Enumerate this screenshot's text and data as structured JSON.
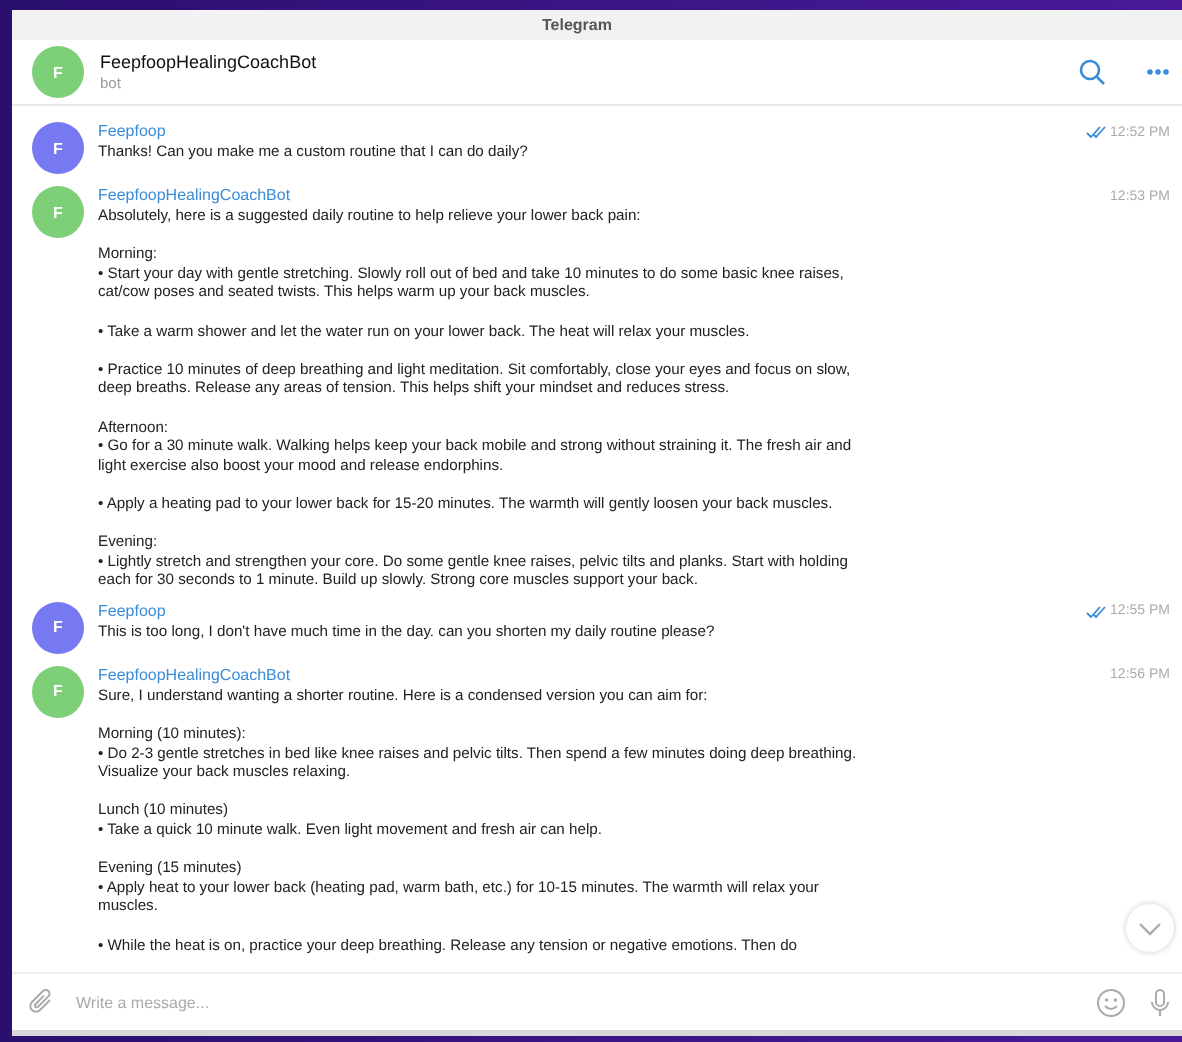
{
  "window": {
    "title": "Telegram"
  },
  "chat_header": {
    "avatar_letter": "F",
    "color": "#7dcf78",
    "name": "FeepfoopHealingCoachBot",
    "status": "bot"
  },
  "messages": [
    {
      "sender": "Feepfoop",
      "avatar_letter": "F",
      "color": "#7679f2",
      "time": "12:52 PM",
      "read": true,
      "blocks": [
        [
          "Thanks! Can you make me a custom routine that I can do daily?"
        ]
      ]
    },
    {
      "sender": "FeepfoopHealingCoachBot",
      "avatar_letter": "F",
      "color": "#7dcf78",
      "time": "12:53 PM",
      "read": false,
      "blocks": [
        [
          "Absolutely, here is a suggested daily routine to help relieve your lower back pain:"
        ],
        [
          "Morning:",
          "• Start your day with gentle stretching. Slowly roll out of bed and take 10 minutes to do some basic knee raises, cat/cow poses and seated twists. This helps warm up your back muscles."
        ],
        [
          "• Take a warm shower and let the water run on your lower back. The heat will relax your muscles."
        ],
        [
          "• Practice 10 minutes of deep breathing and light meditation. Sit comfortably, close your eyes and focus on slow, deep breaths. Release any areas of tension. This helps shift your mindset and reduces stress."
        ],
        [
          "Afternoon:",
          "• Go for a 30 minute walk. Walking helps keep your back mobile and strong without straining it. The fresh air and light exercise also boost your mood and release endorphins."
        ],
        [
          "• Apply a heating pad to your lower back for 15-20 minutes. The warmth will gently loosen your back muscles."
        ],
        [
          "Evening:",
          "• Lightly stretch and strengthen your core. Do some gentle knee raises, pelvic tilts and planks. Start with holding each for 30 seconds to 1 minute. Build up slowly. Strong core muscles support your back."
        ]
      ]
    },
    {
      "sender": "Feepfoop",
      "avatar_letter": "F",
      "color": "#7679f2",
      "time": "12:55 PM",
      "read": true,
      "blocks": [
        [
          "This is too long, I don't have much time in the day. can you shorten my daily routine please?"
        ]
      ]
    },
    {
      "sender": "FeepfoopHealingCoachBot",
      "avatar_letter": "F",
      "color": "#7dcf78",
      "time": "12:56 PM",
      "read": false,
      "blocks": [
        [
          "Sure, I understand wanting a shorter routine. Here is a condensed version you can aim for:"
        ],
        [
          "Morning (10 minutes):",
          "• Do 2-3 gentle stretches in bed like knee raises and pelvic tilts. Then spend a few minutes doing deep breathing. Visualize your back muscles relaxing."
        ],
        [
          "Lunch (10 minutes)",
          "• Take a quick 10 minute walk. Even light movement and fresh air can help."
        ],
        [
          "Evening (15 minutes)",
          "• Apply heat to your lower back (heating pad, warm bath, etc.) for 10-15 minutes. The warmth will relax your muscles."
        ],
        [
          "• While the heat is on, practice your deep breathing. Release any tension or negative emotions. Then do"
        ]
      ]
    }
  ],
  "composer": {
    "placeholder": "Write a message..."
  }
}
